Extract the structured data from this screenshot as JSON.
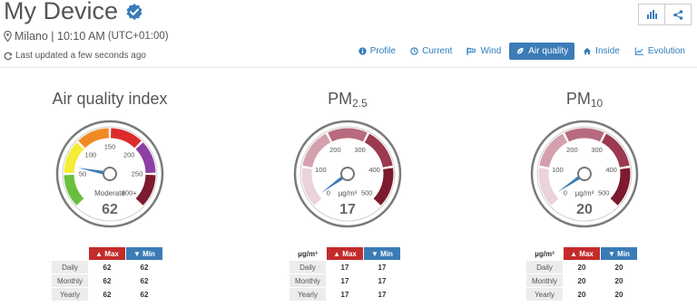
{
  "header": {
    "title": "My Device",
    "verified_icon": "verified-badge-icon",
    "location": "Milano | 10:10 AM",
    "timezone": "(UTC+01:00)",
    "last_updated": "Last updated a few seconds ago"
  },
  "toolbar": {
    "chart_icon": "bar-chart-icon",
    "share_icon": "share-icon"
  },
  "tabs": [
    {
      "label": "Profile",
      "icon": "info-icon",
      "active": false
    },
    {
      "label": "Current",
      "icon": "clock-icon",
      "active": false
    },
    {
      "label": "Wind",
      "icon": "windsock-icon",
      "active": false
    },
    {
      "label": "Air quality",
      "icon": "leaf-icon",
      "active": true
    },
    {
      "label": "Inside",
      "icon": "home-icon",
      "active": false
    },
    {
      "label": "Evolution",
      "icon": "line-chart-icon",
      "active": false
    }
  ],
  "gauges": [
    {
      "title": "Air quality index",
      "value_text": "62",
      "value": 62,
      "min": 0,
      "max": 300,
      "category": "Moderate",
      "ticks": [
        "50",
        "100",
        "150",
        "200",
        "250",
        "300+"
      ],
      "unit": "",
      "stats": {
        "unit": "",
        "max_label": "Max",
        "min_label": "Min",
        "rows": [
          {
            "label": "Daily",
            "max": "62",
            "min": "62"
          },
          {
            "label": "Monthly",
            "max": "62",
            "min": "62"
          },
          {
            "label": "Yearly",
            "max": "62",
            "min": "62"
          }
        ]
      }
    },
    {
      "title": "PM",
      "title_sub": "2.5",
      "value_text": "17",
      "value": 17,
      "min": 0,
      "max": 500,
      "ticks": [
        "0",
        "100",
        "200",
        "300",
        "400",
        "500"
      ],
      "unit": "µg/m³",
      "stats": {
        "unit": "µg/m³",
        "max_label": "Max",
        "min_label": "Min",
        "rows": [
          {
            "label": "Daily",
            "max": "17",
            "min": "17"
          },
          {
            "label": "Monthly",
            "max": "17",
            "min": "17"
          },
          {
            "label": "Yearly",
            "max": "17",
            "min": "17"
          }
        ]
      }
    },
    {
      "title": "PM",
      "title_sub": "10",
      "value_text": "20",
      "value": 20,
      "min": 0,
      "max": 500,
      "ticks": [
        "0",
        "100",
        "200",
        "300",
        "400",
        "500"
      ],
      "unit": "µg/m³",
      "stats": {
        "unit": "µg/m³",
        "max_label": "Max",
        "min_label": "Min",
        "rows": [
          {
            "label": "Daily",
            "max": "20",
            "min": "20"
          },
          {
            "label": "Monthly",
            "max": "20",
            "min": "20"
          },
          {
            "label": "Yearly",
            "max": "20",
            "min": "20"
          }
        ]
      }
    }
  ],
  "colors": {
    "accent": "#3b7bb7",
    "max_header": "#c42b2b",
    "aqi_bands": [
      "#6abf40",
      "#f5ec35",
      "#f08a24",
      "#dd2b2b",
      "#8e3fa3",
      "#7d1a2e"
    ],
    "pm_bands": [
      "#ead3da",
      "#d4a0ae",
      "#b86b7e",
      "#9b3a50",
      "#7d1a2e"
    ]
  }
}
